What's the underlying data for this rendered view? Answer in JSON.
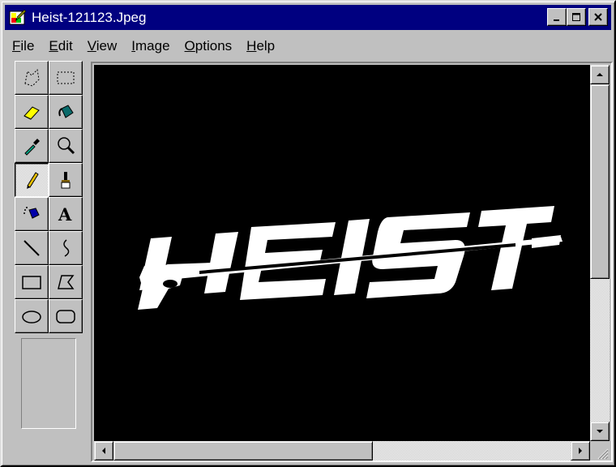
{
  "window": {
    "title": "Heist-121123.Jpeg",
    "app_icon": "paintbrush-app-icon",
    "controls": [
      "minimize-icon",
      "maximize-icon",
      "close-icon"
    ]
  },
  "menu": [
    {
      "label": "File",
      "mnemonic": "F",
      "rest": "ile"
    },
    {
      "label": "Edit",
      "mnemonic": "E",
      "rest": "dit"
    },
    {
      "label": "View",
      "mnemonic": "V",
      "rest": "iew"
    },
    {
      "label": "Image",
      "mnemonic": "I",
      "rest": "mage"
    },
    {
      "label": "Options",
      "mnemonic": "O",
      "rest": "ptions"
    },
    {
      "label": "Help",
      "mnemonic": "H",
      "rest": "elp"
    }
  ],
  "tools": [
    {
      "name": "free-form-select-icon",
      "active": false
    },
    {
      "name": "rect-select-icon",
      "active": false
    },
    {
      "name": "eraser-icon",
      "active": false
    },
    {
      "name": "fill-bucket-icon",
      "active": false
    },
    {
      "name": "color-picker-icon",
      "active": false
    },
    {
      "name": "magnifier-icon",
      "active": false
    },
    {
      "name": "pencil-icon",
      "active": true
    },
    {
      "name": "brush-icon",
      "active": false
    },
    {
      "name": "airbrush-icon",
      "active": false
    },
    {
      "name": "text-icon",
      "active": false
    },
    {
      "name": "line-icon",
      "active": false
    },
    {
      "name": "curve-icon",
      "active": false
    },
    {
      "name": "rectangle-icon",
      "active": false
    },
    {
      "name": "polygon-icon",
      "active": false
    },
    {
      "name": "ellipse-icon",
      "active": false
    },
    {
      "name": "rounded-rect-icon",
      "active": false
    }
  ],
  "canvas": {
    "background": "#000000",
    "logo_text": "HEIST",
    "logo_color": "#ffffff"
  },
  "scroll": {
    "vertical_position": 0.0,
    "horizontal_position": 0.0
  }
}
